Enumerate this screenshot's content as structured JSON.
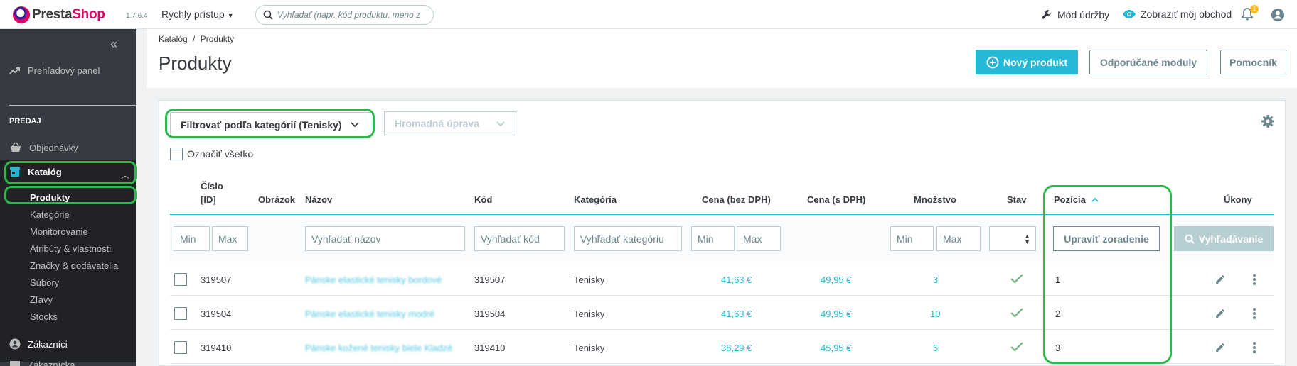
{
  "header": {
    "logo_pre": "Presta",
    "logo_shop": "Shop",
    "version": "1.7.6.4",
    "quick_access": "Rýchly prístup",
    "search_placeholder": "Vyhľadať (napr. kód produktu, meno záká",
    "maintenance": "Mód údržby",
    "view_shop": "Zobraziť môj obchod",
    "notification_count": "1"
  },
  "sidebar": {
    "dashboard": "Prehľadový panel",
    "section_sell": "PREDAJ",
    "orders": "Objednávky",
    "catalog": "Katalóg",
    "catalog_sub": [
      "Produkty",
      "Kategórie",
      "Monitorovanie",
      "Atribúty & vlastnosti",
      "Značky & dodávatelia",
      "Súbory",
      "Zľavy",
      "Stocks"
    ],
    "customers": "Zákazníci",
    "next_partial": "Zákaznícka..."
  },
  "page": {
    "breadcrumb_parent": "Katalóg",
    "breadcrumb_sep": "/",
    "breadcrumb_current": "Produkty",
    "title": "Produkty",
    "new_product": "Nový produkt",
    "recommended_modules": "Odporúčané moduly",
    "help": "Pomocník"
  },
  "toolbar": {
    "filter_category": "Filtrovať podľa kategórií (Tenisky)",
    "bulk_edit": "Hromadná úprava",
    "select_all": "Označiť všetko"
  },
  "table": {
    "headers": {
      "id_line1": "Číslo",
      "id_line2": "[ID]",
      "image": "Obrázok",
      "name": "Názov",
      "reference": "Kód",
      "category": "Kategória",
      "price_excl": "Cena (bez DPH)",
      "price_incl": "Cena (s DPH)",
      "quantity": "Množstvo",
      "status": "Stav",
      "position": "Pozícia",
      "actions": "Úkony"
    },
    "filters": {
      "min": "Min",
      "max": "Max",
      "name_placeholder": "Vyhľadať názov",
      "reference_placeholder": "Vyhľadať kód",
      "category_placeholder": "Vyhľadať kategóriu",
      "reorder": "Upraviť zoradenie",
      "search": "Vyhľadávanie"
    },
    "rows": [
      {
        "id": "319507",
        "name": "Pánske elastické tenisky bordové",
        "reference": "319507",
        "category": "Tenisky",
        "price_excl": "41,63 €",
        "price_incl": "49,95 €",
        "quantity": "3",
        "position": "1"
      },
      {
        "id": "319504",
        "name": "Pánske elastické tenisky modré",
        "reference": "319504",
        "category": "Tenisky",
        "price_excl": "41,63 €",
        "price_incl": "49,95 €",
        "quantity": "10",
        "position": "2"
      },
      {
        "id": "319410",
        "name": "Pánske kožené tenisky biele Kladzé",
        "reference": "319410",
        "category": "Tenisky",
        "price_excl": "38,29 €",
        "price_incl": "45,95 €",
        "quantity": "5",
        "position": "3"
      }
    ]
  },
  "colors": {
    "accent": "#25b9d7",
    "brand": "#df0067",
    "sidebar": "#363a41",
    "annotation": "#2db84b",
    "status_ok": "#70b580"
  },
  "icons": [
    "ps-logo-icon",
    "search-icon",
    "wrench-icon",
    "eye-icon",
    "bell-icon",
    "user-icon",
    "collapse-icon",
    "trend-icon",
    "basket-icon",
    "store-icon",
    "chevron-up-icon",
    "plus-circle-icon",
    "chevron-down-icon",
    "gear-icon",
    "sort-up-icon",
    "check-icon",
    "pencil-icon",
    "more-vertical-icon",
    "account-icon"
  ]
}
